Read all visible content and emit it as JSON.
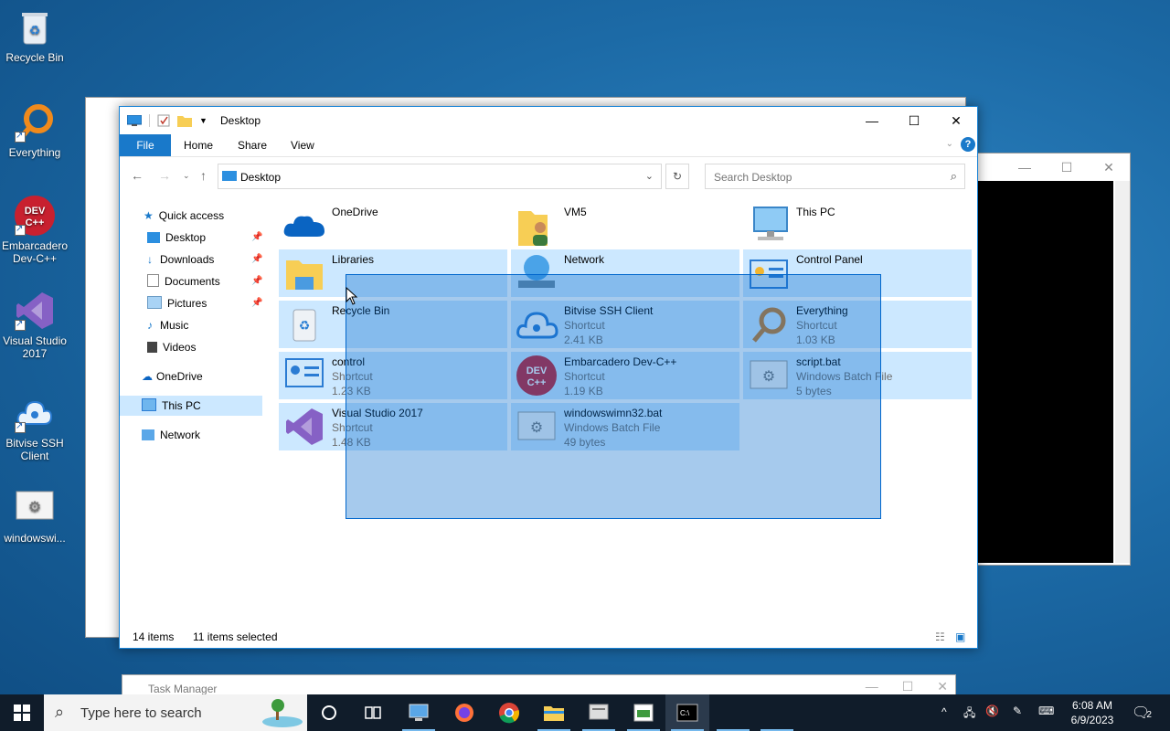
{
  "desktop": {
    "icons": [
      {
        "label": "Recycle Bin"
      },
      {
        "label": "Everything"
      },
      {
        "label": "Embarcadero Dev-C++"
      },
      {
        "label": "Visual Studio 2017"
      },
      {
        "label": "Bitvise SSH Client"
      },
      {
        "label": "windowswi..."
      }
    ]
  },
  "explorer": {
    "title": "Desktop",
    "ribbon_tabs": [
      "File",
      "Home",
      "Share",
      "View"
    ],
    "address": "Desktop",
    "search_placeholder": "Search Desktop",
    "nav": {
      "quick_access": "Quick access",
      "items": [
        "Desktop",
        "Downloads",
        "Documents",
        "Pictures",
        "Music",
        "Videos"
      ],
      "onedrive": "OneDrive",
      "this_pc": "This PC",
      "network": "Network"
    },
    "files": [
      {
        "name": "OneDrive",
        "type": "",
        "size": ""
      },
      {
        "name": "VM5",
        "type": "",
        "size": ""
      },
      {
        "name": "This PC",
        "type": "",
        "size": ""
      },
      {
        "name": "Libraries",
        "type": "",
        "size": ""
      },
      {
        "name": "Network",
        "type": "",
        "size": ""
      },
      {
        "name": "Control Panel",
        "type": "",
        "size": ""
      },
      {
        "name": "Recycle Bin",
        "type": "",
        "size": ""
      },
      {
        "name": "Bitvise SSH Client",
        "type": "Shortcut",
        "size": "2.41 KB"
      },
      {
        "name": "Everything",
        "type": "Shortcut",
        "size": "1.03 KB"
      },
      {
        "name": "control",
        "type": "Shortcut",
        "size": "1.23 KB"
      },
      {
        "name": "Embarcadero Dev-C++",
        "type": "Shortcut",
        "size": "1.19 KB"
      },
      {
        "name": "script.bat",
        "type": "Windows Batch File",
        "size": "5 bytes"
      },
      {
        "name": "Visual Studio 2017",
        "type": "Shortcut",
        "size": "1.48 KB"
      },
      {
        "name": "windowswimn32.bat",
        "type": "Windows Batch File",
        "size": "49 bytes"
      }
    ],
    "status": {
      "count": "14 items",
      "selected": "11 items selected"
    }
  },
  "taskmgr": {
    "title": "Task Manager"
  },
  "taskbar": {
    "search_placeholder": "Type here to search",
    "time": "6:08 AM",
    "date": "6/9/2023",
    "notifications": "2"
  },
  "colors": {
    "accent": "#1979ca",
    "selection": "#cce8ff",
    "taskbar": "#101c2a"
  }
}
